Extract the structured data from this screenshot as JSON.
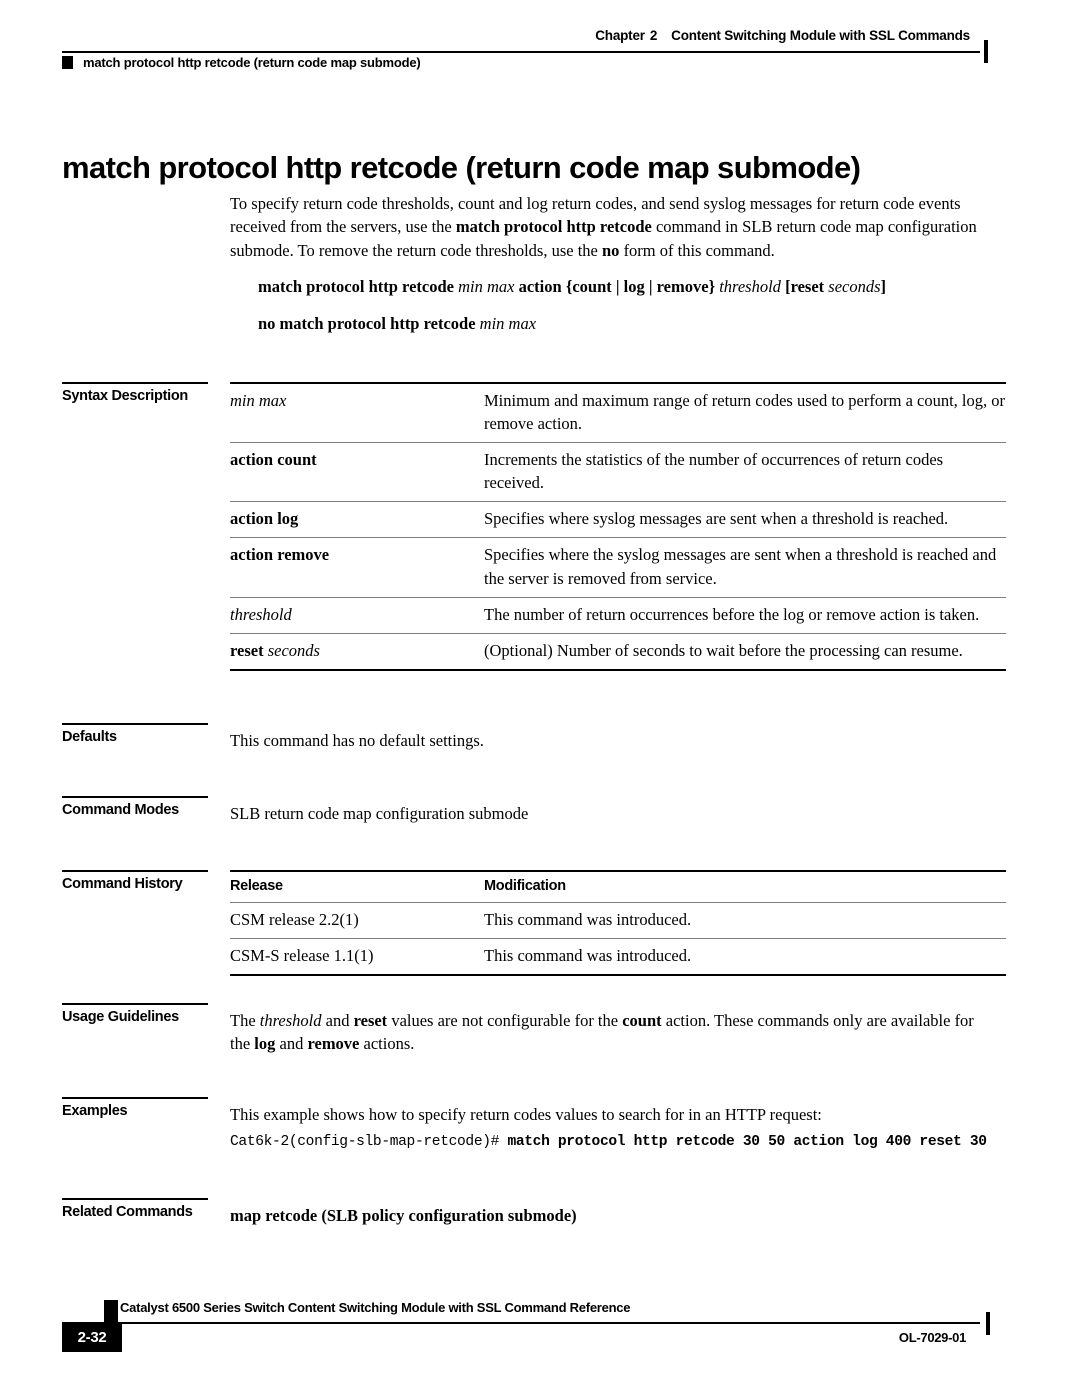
{
  "header": {
    "chapter_label": "Chapter",
    "chapter_number": "2",
    "chapter_title": "Content Switching Module with SSL Commands",
    "command_name": "match protocol http retcode (return code map submode)"
  },
  "title": "match protocol http retcode (return code map submode)",
  "intro": {
    "part1": "To specify return code thresholds, count and log return codes, and send syslog messages for return code events received from the servers, use the ",
    "bold1": "match protocol http retcode",
    "part2": " command in SLB return code map configuration submode. To remove the return code thresholds, use the ",
    "bold2": "no",
    "part3": " form of this command."
  },
  "syntax": {
    "line1": {
      "b1": "match protocol http retcode ",
      "i1": "min max ",
      "b2": "action ",
      "t1": "{",
      "b3": "count",
      "t2": " | ",
      "b4": "log",
      "t3": " | ",
      "b5": "remove",
      "t4": "} ",
      "i2": "threshold ",
      "t5": "[",
      "b6": "reset ",
      "i3": "seconds",
      "t6": "]"
    },
    "line2": {
      "b1": "no match protocol http retcode ",
      "i1": "min max"
    }
  },
  "sections": {
    "syntax_description": "Syntax Description",
    "defaults": "Defaults",
    "command_modes": "Command Modes",
    "command_history": "Command History",
    "usage_guidelines": "Usage Guidelines",
    "examples": "Examples",
    "related_commands": "Related Commands"
  },
  "syntax_table": {
    "rows": [
      {
        "term_plain": "",
        "term_bold": "",
        "term_italic": "min max",
        "description": "Minimum and maximum range of return codes used to perform a count, log, or remove action."
      },
      {
        "term_plain": "",
        "term_bold": "action count",
        "term_italic": "",
        "description": "Increments the statistics of the number of occurrences of return codes received."
      },
      {
        "term_plain": "",
        "term_bold": "action log",
        "term_italic": "",
        "description": "Specifies where syslog messages are sent when a threshold is reached."
      },
      {
        "term_plain": "",
        "term_bold": "action remove",
        "term_italic": "",
        "description": "Specifies where the syslog messages are sent when a threshold is reached and the server is removed from service."
      },
      {
        "term_plain": "",
        "term_bold": "",
        "term_italic": "threshold",
        "description": "The number of return occurrences before the log or remove action is taken."
      },
      {
        "term_plain": "",
        "term_bold": "reset ",
        "term_italic": "seconds",
        "description": "(Optional) Number of seconds to wait before the processing can resume."
      }
    ]
  },
  "defaults_text": "This command has no default settings.",
  "command_modes_text": "SLB return code map configuration submode",
  "command_history": {
    "headers": [
      "Release",
      "Modification"
    ],
    "rows": [
      [
        "CSM release 2.2(1)",
        "This command was introduced."
      ],
      [
        "CSM-S release 1.1(1)",
        "This command was introduced."
      ]
    ]
  },
  "usage_guidelines": {
    "p1": "The ",
    "i1": "threshold",
    "p2": " and ",
    "b1": "reset",
    "p3": " values are not configurable for the ",
    "b2": "count",
    "p4": " action. These commands only are available for the ",
    "b3": "log",
    "p5": " and ",
    "b4": "remove",
    "p6": " actions."
  },
  "examples": {
    "intro": "This example shows how to specify return codes values to search for in an HTTP request:",
    "prompt": "Cat6k-2(config-slb-map-retcode)#",
    "command": " match protocol http retcode 30 50 action log 400 reset 30"
  },
  "related_commands": "map retcode (SLB policy configuration submode)",
  "footer": {
    "doc_title": "Catalyst 6500 Series Switch Content Switching Module with SSL Command Reference",
    "page_number": "2-32",
    "doc_id": "OL-7029-01"
  }
}
